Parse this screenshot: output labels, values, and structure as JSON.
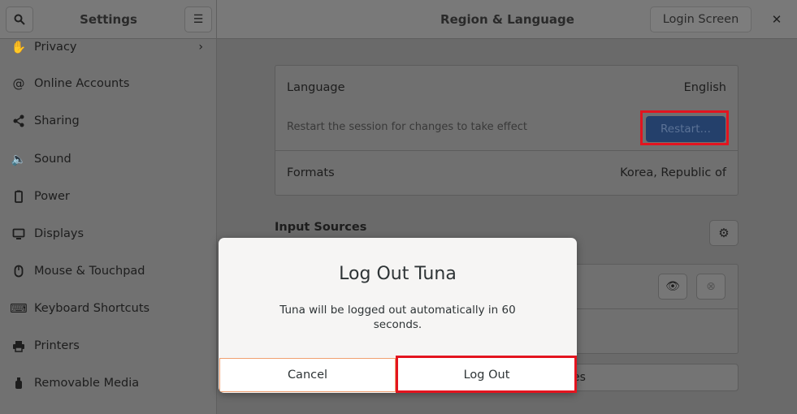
{
  "header": {
    "sidebar_title": "Settings",
    "main_title": "Region & Language",
    "login_screen_label": "Login Screen"
  },
  "sidebar": {
    "items": [
      {
        "label": "Privacy",
        "icon": "hand-icon"
      },
      {
        "label": "Online Accounts",
        "icon": "at-icon"
      },
      {
        "label": "Sharing",
        "icon": "share-icon"
      },
      {
        "label": "Sound",
        "icon": "speaker-icon"
      },
      {
        "label": "Power",
        "icon": "power-icon"
      },
      {
        "label": "Displays",
        "icon": "display-icon"
      },
      {
        "label": "Mouse & Touchpad",
        "icon": "mouse-icon"
      },
      {
        "label": "Keyboard Shortcuts",
        "icon": "keyboard-icon"
      },
      {
        "label": "Printers",
        "icon": "printer-icon"
      },
      {
        "label": "Removable Media",
        "icon": "usb-icon"
      }
    ]
  },
  "language": {
    "label": "Language",
    "value": "English",
    "hint": "Restart the session for changes to take effect",
    "restart_label": "Restart…"
  },
  "formats": {
    "label": "Formats",
    "value": "Korea, Republic of"
  },
  "input_sources": {
    "title": "Input Sources",
    "options_fragment": "es"
  },
  "dialog": {
    "title": "Log Out Tuna",
    "body": "Tuna will be logged out automatically in 60 seconds.",
    "cancel_label": "Cancel",
    "logout_label": "Log Out"
  },
  "colors": {
    "highlight": "#e3141f",
    "restart_button": "#24406b"
  }
}
